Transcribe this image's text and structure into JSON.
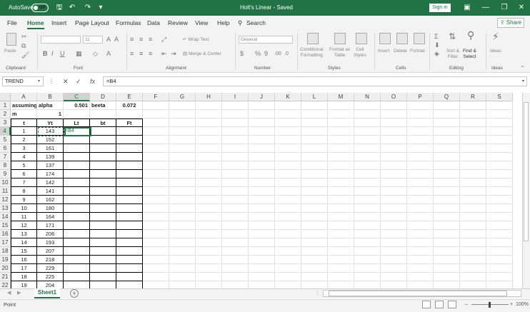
{
  "titlebar": {
    "autosave_label": "AutoSave",
    "autosave_state": "Off",
    "doc_title": "Holt's Linear  -  Saved",
    "signin": "Sign in"
  },
  "tabs": [
    "File",
    "Home",
    "Insert",
    "Page Layout",
    "Formulas",
    "Data",
    "Review",
    "View",
    "Help"
  ],
  "search_label": "Search",
  "share_label": "Share",
  "ribbon": {
    "clipboard": {
      "label": "Clipboard",
      "paste": "Paste"
    },
    "font": {
      "label": "Font",
      "size": "11"
    },
    "alignment": {
      "label": "Alignment",
      "wrap": "Wrap Text",
      "merge": "Merge & Center"
    },
    "number": {
      "label": "Number",
      "format": "General",
      "currency": "$",
      "percent": "%",
      "comma": "9"
    },
    "styles": {
      "label": "Styles",
      "conditional": "Conditional",
      "formatting": "Formatting",
      "format_as": "Format as",
      "table": "Table",
      "cell": "Cell",
      "styles_txt": "Styles"
    },
    "cells": {
      "label": "Cells",
      "insert": "Insert",
      "delete": "Delete",
      "format": "Format"
    },
    "editing": {
      "label": "Editing",
      "sort": "Sort &",
      "filter": "Filter",
      "find": "Find &",
      "select": "Select"
    },
    "ideas": {
      "label": "Ideas",
      "ideas": "Ideas"
    }
  },
  "formula_bar": {
    "name_box": "TREND",
    "formula": "=B4",
    "cancel": "✕",
    "enter": "✓",
    "fx": "fx"
  },
  "columns": [
    "A",
    "B",
    "C",
    "D",
    "E",
    "F",
    "G",
    "H",
    "I",
    "J",
    "K",
    "L",
    "M",
    "N",
    "O",
    "P",
    "Q",
    "R",
    "S"
  ],
  "rows": [
    "1",
    "2",
    "3",
    "4",
    "5",
    "6",
    "7",
    "8",
    "9",
    "10",
    "11",
    "12",
    "13",
    "14",
    "15",
    "16",
    "17",
    "18",
    "19",
    "20",
    "21",
    "22"
  ],
  "cells": {
    "r1": {
      "A": "assuming",
      "B": "alpha",
      "C": "0.501",
      "D": "beeta",
      "E": "0.072"
    },
    "r2": {
      "A": "m",
      "B": "1"
    },
    "r3": {
      "A": "t",
      "B": "Yt",
      "C": "Lt",
      "D": "bt",
      "E": "Ft"
    },
    "r4_c": "=B4",
    "t": [
      "1",
      "2",
      "3",
      "4",
      "5",
      "6",
      "7",
      "8",
      "9",
      "10",
      "11",
      "12",
      "13",
      "14",
      "15",
      "16",
      "17",
      "18",
      "19"
    ],
    "yt": [
      "143",
      "152",
      "161",
      "139",
      "137",
      "174",
      "142",
      "141",
      "162",
      "180",
      "164",
      "171",
      "206",
      "193",
      "207",
      "218",
      "229",
      "225",
      "204"
    ]
  },
  "sheet_tab": "Sheet1",
  "status": {
    "text": "Point",
    "zoom": "100%"
  }
}
